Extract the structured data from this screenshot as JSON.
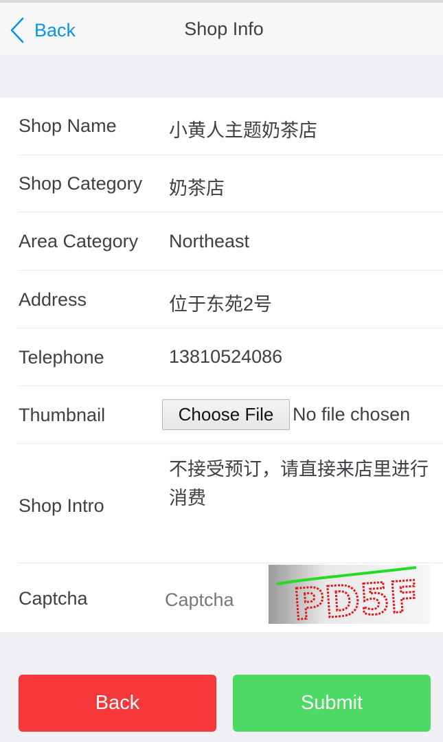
{
  "nav": {
    "back_label": "Back",
    "title": "Shop Info"
  },
  "form": {
    "shop_name": {
      "label": "Shop Name",
      "value": "小黄人主题奶茶店"
    },
    "shop_category": {
      "label": "Shop Category",
      "value": "奶茶店"
    },
    "area_category": {
      "label": "Area Category",
      "value": "Northeast"
    },
    "address": {
      "label": "Address",
      "value": "位于东苑2号"
    },
    "telephone": {
      "label": "Telephone",
      "value": "13810524086"
    },
    "thumbnail": {
      "label": "Thumbnail",
      "button_label": "Choose File",
      "status": "No file chosen"
    },
    "shop_intro": {
      "label": "Shop Intro",
      "value": "不接受预订，请直接来店里进行消费"
    },
    "captcha": {
      "label": "Captcha",
      "placeholder": "Captcha",
      "image_text": "PD5F"
    }
  },
  "buttons": {
    "back_label": "Back",
    "submit_label": "Submit"
  },
  "colors": {
    "link": "#0894ec",
    "danger": "#f6383a",
    "success": "#4cd964"
  }
}
